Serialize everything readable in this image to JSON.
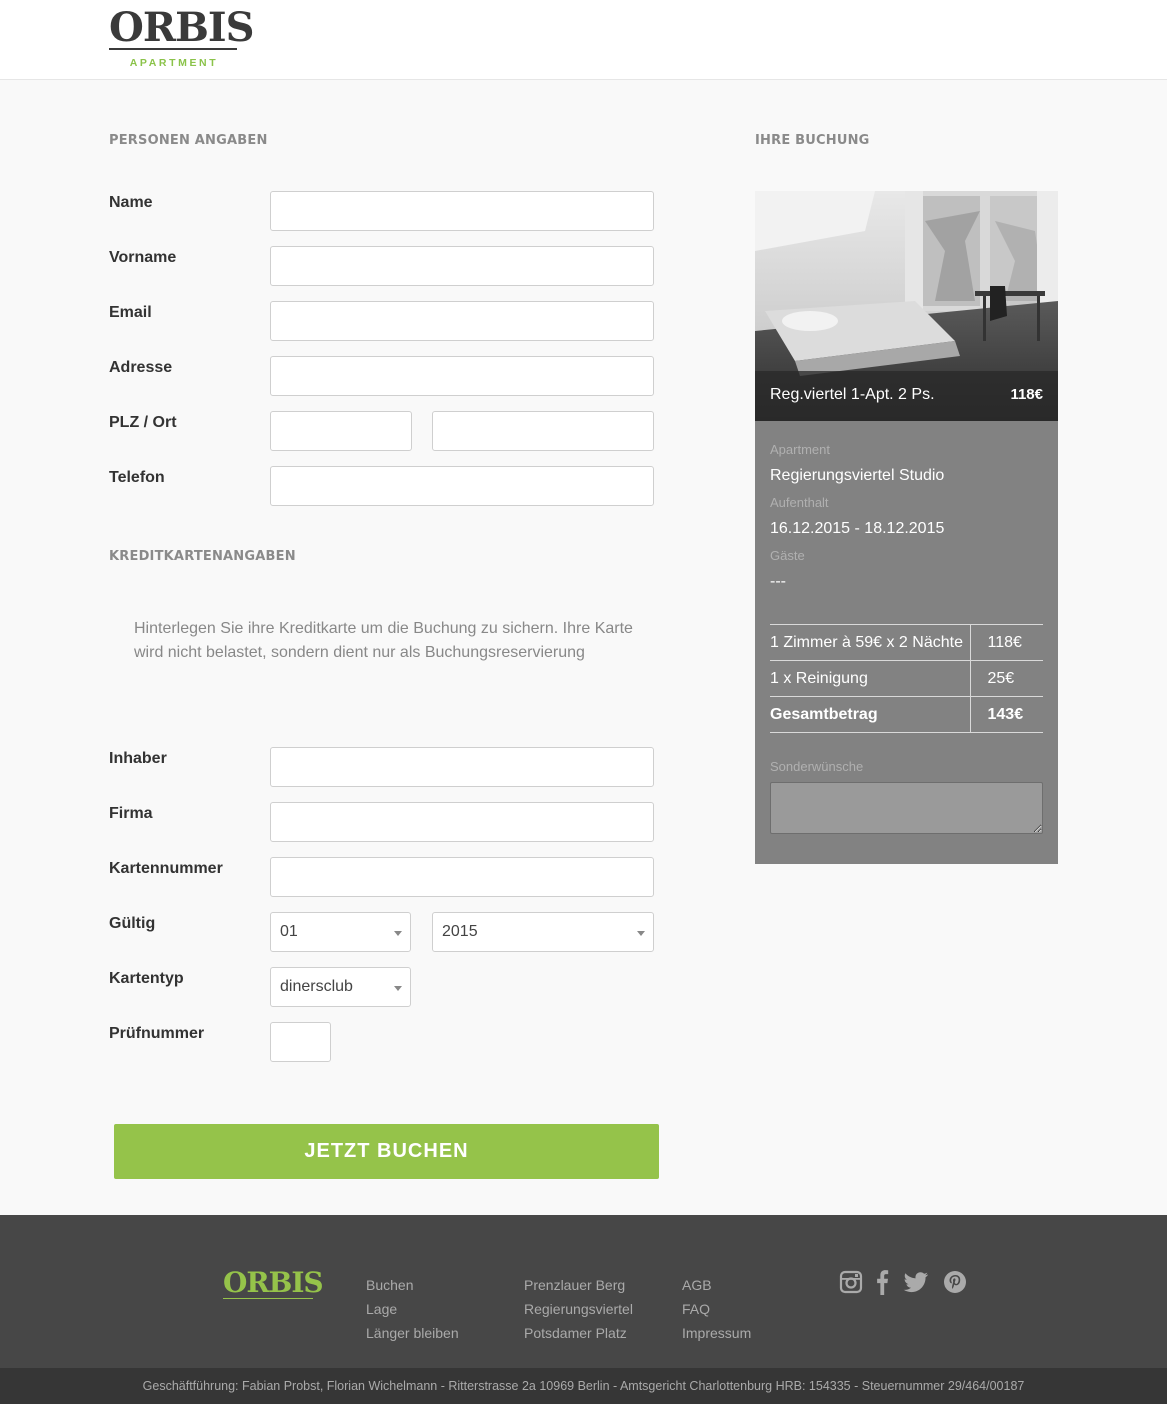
{
  "header": {
    "logo_text": "ORBIS",
    "logo_sub": "APARTMENT"
  },
  "personal": {
    "section_title": "PERSONEN ANGABEN",
    "fields": {
      "name": "Name",
      "vorname": "Vorname",
      "email": "Email",
      "adresse": "Adresse",
      "plz_ort": "PLZ / Ort",
      "telefon": "Telefon"
    }
  },
  "credit": {
    "section_title": "KREDITKARTENANGABEN",
    "note": "Hinterlegen Sie ihre Kreditkarte um die Buchung zu sichern. Ihre Karte wird nicht belastet, sondern dient nur als Buchungsreservierung",
    "fields": {
      "inhaber": "Inhaber",
      "firma": "Firma",
      "kartennummer": "Kartennummer",
      "gueltig": "Gültig",
      "kartentyp": "Kartentyp",
      "pruefnummer": "Prüfnummer"
    },
    "month_value": "01",
    "year_value": "2015",
    "cardtype_value": "dinersclub"
  },
  "book_button": "JETZT BUCHEN",
  "booking": {
    "section_title": "IHRE BUCHUNG",
    "caption_name": "Reg.viertel 1-Apt. 2 Ps.",
    "caption_price": "118€",
    "apartment_label": "Apartment",
    "apartment_value": "Regierungsviertel Studio",
    "stay_label": "Aufenthalt",
    "stay_value": "16.12.2015 - 18.12.2015",
    "guests_label": "Gäste",
    "guests_value": "---",
    "rows": [
      {
        "desc": "1 Zimmer à 59€ x 2 Nächte",
        "amount": "118€"
      },
      {
        "desc": "1 x Reinigung",
        "amount": "25€"
      },
      {
        "desc": "Gesamtbetrag",
        "amount": "143€"
      }
    ],
    "special_label": "Sonderwünsche"
  },
  "footer": {
    "logo_text": "ORBIS",
    "col1": [
      "Buchen",
      "Lage",
      "Länger bleiben"
    ],
    "col2": [
      "Prenzlauer Berg",
      "Regierungsviertel",
      "Potsdamer Platz"
    ],
    "col3": [
      "AGB",
      "FAQ",
      "Impressum"
    ],
    "social_icons": [
      "instagram-icon",
      "facebook-icon",
      "twitter-icon",
      "pinterest-icon"
    ],
    "legal": "Geschäftführung: Fabian Probst, Florian Wichelmann - Ritterstrasse 2a 10969 Berlin - Amtsgericht Charlottenburg HRB: 154335 - Steuernummer 29/464/00187"
  },
  "colors": {
    "accent": "#95c34a",
    "card_bg": "#828282",
    "footer_bg": "#474747"
  }
}
